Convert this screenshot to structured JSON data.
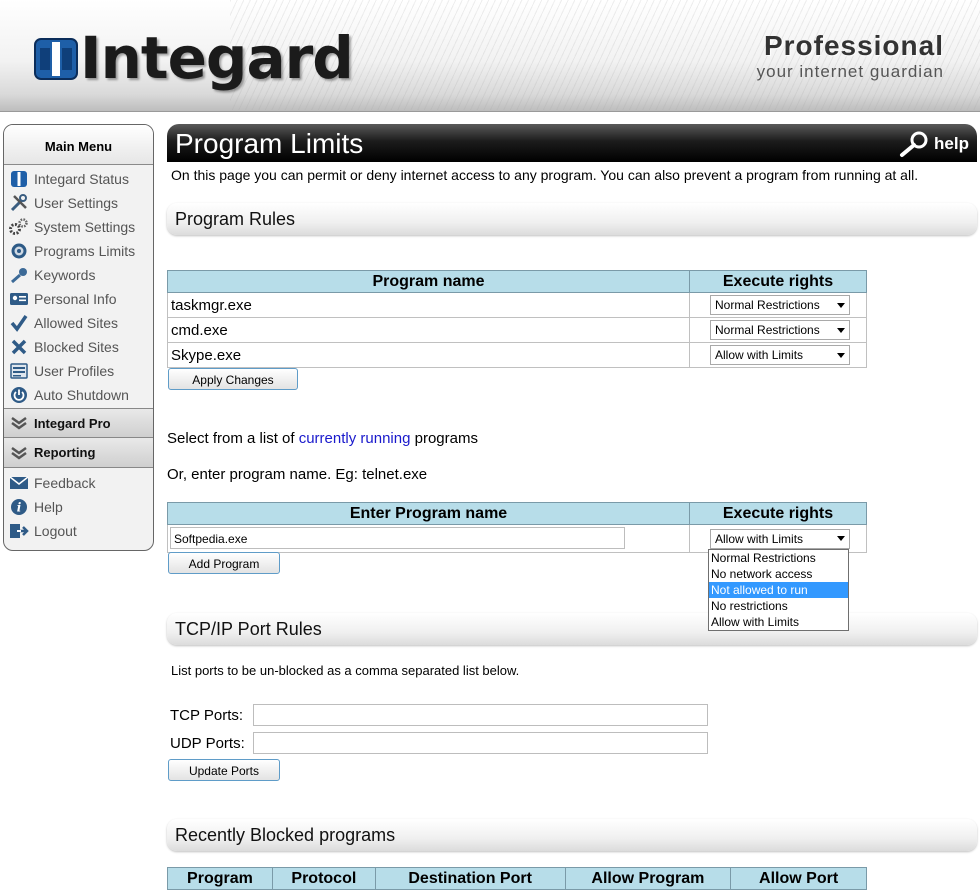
{
  "header": {
    "brand": "Integard",
    "edition": "Professional",
    "tagline": "your internet guardian"
  },
  "sidebar": {
    "title": "Main Menu",
    "items": [
      {
        "label": "Integard Status",
        "icon": "status-icon"
      },
      {
        "label": "User Settings",
        "icon": "tools-icon"
      },
      {
        "label": "System Settings",
        "icon": "gears-icon"
      },
      {
        "label": "Programs Limits",
        "icon": "target-icon"
      },
      {
        "label": "Keywords",
        "icon": "key-icon"
      },
      {
        "label": "Personal Info",
        "icon": "id-card-icon"
      },
      {
        "label": "Allowed Sites",
        "icon": "checkmark-icon"
      },
      {
        "label": "Blocked Sites",
        "icon": "x-mark-icon"
      },
      {
        "label": "User Profiles",
        "icon": "profiles-icon"
      },
      {
        "label": "Auto Shutdown",
        "icon": "power-icon"
      }
    ],
    "sections": [
      {
        "label": "Integard Pro",
        "icon": "chevron-down-icon"
      },
      {
        "label": "Reporting",
        "icon": "chevron-down-icon"
      }
    ],
    "bottom_items": [
      {
        "label": "Feedback",
        "icon": "envelope-icon"
      },
      {
        "label": "Help",
        "icon": "info-icon"
      },
      {
        "label": "Logout",
        "icon": "logout-icon"
      }
    ]
  },
  "page": {
    "title": "Program Limits",
    "help_label": "help",
    "intro": "On this page you can permit or deny internet access to any program. You can also prevent a program from running at all."
  },
  "program_rules": {
    "heading": "Program Rules",
    "columns": [
      "Program name",
      "Execute rights"
    ],
    "rows": [
      {
        "name": "taskmgr.exe",
        "rights": "Normal Restrictions"
      },
      {
        "name": "cmd.exe",
        "rights": "Normal Restrictions"
      },
      {
        "name": "Skype.exe",
        "rights": "Allow with Limits"
      }
    ],
    "apply_label": "Apply Changes"
  },
  "select_line": {
    "prefix": "Select from a list of",
    "link": "currently running",
    "suffix": "programs"
  },
  "enter_line": "Or, enter program name. Eg: telnet.exe",
  "add_program": {
    "columns": [
      "Enter Program name",
      "Execute rights"
    ],
    "name_value": "Softpedia.exe",
    "rights_value": "Allow with Limits",
    "options": [
      "Normal Restrictions",
      "No network access",
      "Not allowed to run",
      "No restrictions",
      "Allow with Limits"
    ],
    "highlighted_option": "Not allowed to run",
    "add_label": "Add Program"
  },
  "ports": {
    "heading": "TCP/IP Port Rules",
    "description": "List ports to be un-blocked as a comma separated list below.",
    "tcp_label": "TCP Ports:",
    "udp_label": "UDP Ports:",
    "tcp_value": "",
    "udp_value": "",
    "update_label": "Update Ports"
  },
  "recent": {
    "heading": "Recently Blocked programs",
    "columns": [
      "Program",
      "Protocol",
      "Destination Port",
      "Allow Program",
      "Allow Port"
    ]
  },
  "colors": {
    "table_header": "#b7dde9",
    "button_border": "#5f9cc8",
    "logo_blue": "#1e5fa8",
    "link": "#1a1acc",
    "highlight": "#3399ff"
  }
}
